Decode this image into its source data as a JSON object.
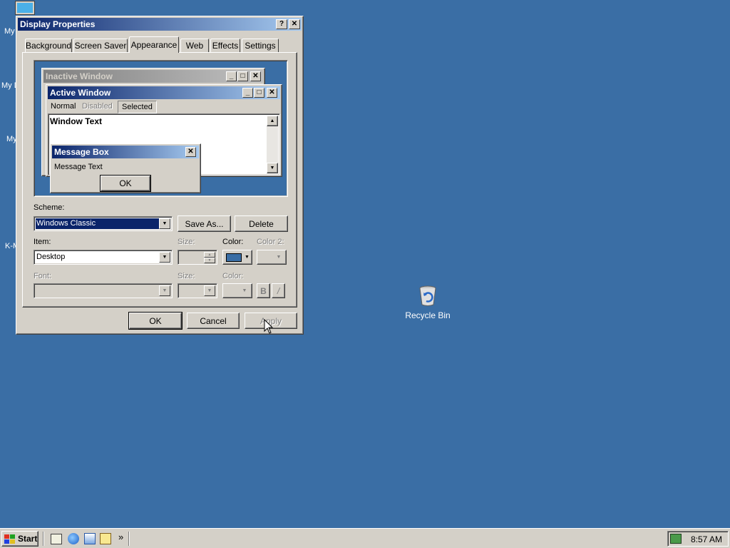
{
  "desktop": {
    "partial_labels": [
      "My",
      "My D",
      "My",
      "K-M"
    ],
    "recycle_bin_label": "Recycle Bin"
  },
  "dialog": {
    "title": "Display Properties",
    "help_btn": "?",
    "close_btn": "✕",
    "tabs": [
      "Background",
      "Screen Saver",
      "Appearance",
      "Web",
      "Effects",
      "Settings"
    ],
    "active_tab": "Appearance",
    "preview": {
      "inactive_title": "Inactive Window",
      "active_title": "Active Window",
      "menu": [
        "Normal",
        "Disabled",
        "Selected"
      ],
      "window_text": "Window Text",
      "msgbox_title": "Message Box",
      "msgbox_text": "Message Text",
      "msgbox_ok": "OK"
    },
    "scheme_label": "Scheme:",
    "scheme_value": "Windows Classic",
    "save_as": "Save As...",
    "delete": "Delete",
    "item_label": "Item:",
    "item_value": "Desktop",
    "size_label": "Size:",
    "color_label": "Color:",
    "color2_label": "Color 2:",
    "font_label": "Font:",
    "font_size_label": "Size:",
    "font_color_label": "Color:",
    "bold_btn": "B",
    "italic_btn": "/",
    "ok": "OK",
    "cancel": "Cancel",
    "apply": "Apply",
    "item_color": "#3a6ea5"
  },
  "taskbar": {
    "start": "Start",
    "chevron": "»",
    "clock": "8:57 AM"
  }
}
